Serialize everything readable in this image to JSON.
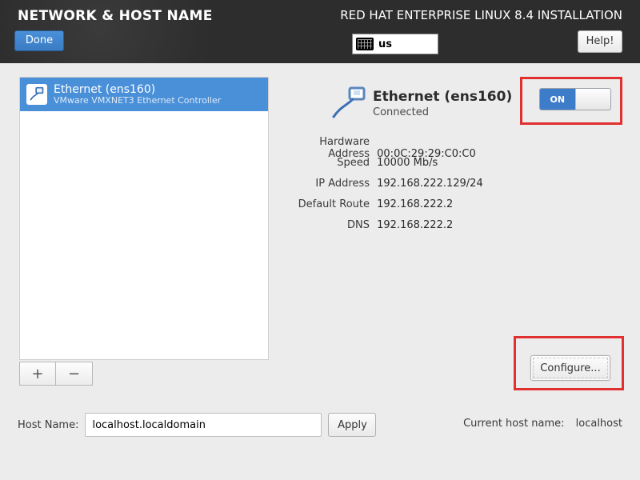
{
  "header": {
    "page_title": "NETWORK & HOST NAME",
    "installer_title": "RED HAT ENTERPRISE LINUX 8.4 INSTALLATION",
    "done_label": "Done",
    "help_label": "Help!",
    "keyboard_layout": "us"
  },
  "interfaces": {
    "items": [
      {
        "name": "Ethernet (ens160)",
        "subtitle": "VMware VMXNET3 Ethernet Controller"
      }
    ],
    "add_label": "+",
    "remove_label": "−"
  },
  "detail": {
    "name": "Ethernet (ens160)",
    "status": "Connected",
    "toggle_on_label": "ON",
    "labels": {
      "hardware_address": "Hardware Address",
      "speed": "Speed",
      "ip_address": "IP Address",
      "default_route": "Default Route",
      "dns": "DNS"
    },
    "values": {
      "hardware_address": "00:0C:29:29:C0:C0",
      "speed": "10000 Mb/s",
      "ip_address": "192.168.222.129/24",
      "default_route": "192.168.222.2",
      "dns": "192.168.222.2"
    },
    "configure_label": "Configure..."
  },
  "hostname": {
    "label": "Host Name:",
    "value": "localhost.localdomain",
    "apply_label": "Apply",
    "current_label": "Current host name:",
    "current_value": "localhost"
  },
  "colors": {
    "accent": "#4a90d9",
    "highlight": "#e03030"
  }
}
